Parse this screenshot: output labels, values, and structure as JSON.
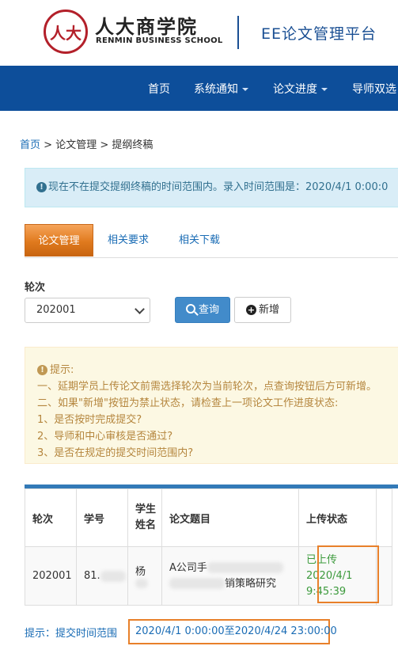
{
  "header": {
    "logo_seal_text": "人大",
    "logo_cn": "人大商学院",
    "logo_en": "RENMIN BUSINESS SCHOOL",
    "platform_title": "EE论文管理平台",
    "brand_color": "#0d4e9a"
  },
  "nav": {
    "items": [
      {
        "label": "首页"
      },
      {
        "label": "系统通知"
      },
      {
        "label": "论文进度"
      },
      {
        "label": "导师双选"
      }
    ]
  },
  "breadcrumb": {
    "home": "首页",
    "sep1": " > ",
    "level2": "论文管理",
    "sep2": " > ",
    "current": "提纲终稿"
  },
  "info_alert": {
    "text": "现在不在提交提纲终稿的时间范围内。录入时间范围是：2020/4/1 0:00:0"
  },
  "tabs": [
    {
      "label": "论文管理",
      "active": true
    },
    {
      "label": "相关要求"
    },
    {
      "label": "相关下载"
    }
  ],
  "form": {
    "round_label": "轮次",
    "round_value": "202001",
    "search_label": "查询",
    "add_label": "新增"
  },
  "warning": {
    "title": "提示:",
    "lines": [
      "一、延期学员上传论文前需选择轮次为当前轮次，点查询按钮后方可新增。",
      "二、如果\"新增\"按钮为禁止状态，请检查上一项论文工作进度状态:",
      "1、是否按时完成提交?",
      "2、导师和中心审核是否通过?",
      "3、是否在规定的提交时间范围内?"
    ]
  },
  "table": {
    "headers": [
      "轮次",
      "学号",
      "学生姓名",
      "论文题目",
      "上传状态"
    ],
    "row": {
      "round": "202001",
      "student_id": "81.",
      "name_partial": "杨",
      "title_line1": "A公司手",
      "title_line2": "销策略研究",
      "status": "已上传",
      "status_date": "2020/4/1",
      "status_time": "9:45:39"
    }
  },
  "footer": {
    "hint": "提示：提交时间范围",
    "range": "2020/4/1 0:00:00至2020/4/24 23:00:00"
  }
}
